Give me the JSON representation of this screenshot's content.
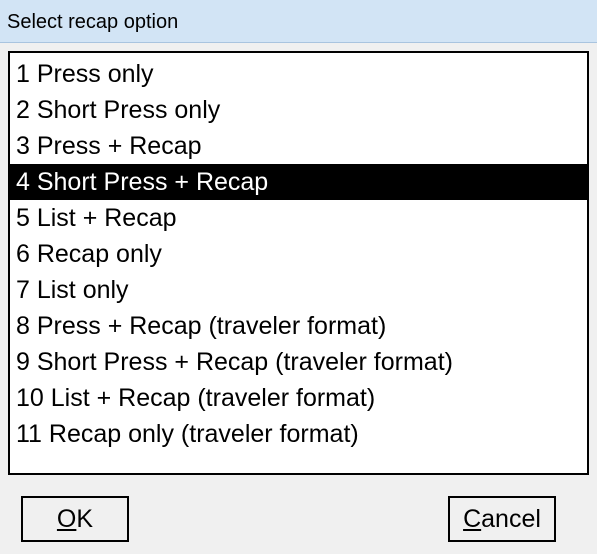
{
  "window": {
    "title": "Select recap option"
  },
  "list": {
    "selected_index": 3,
    "items": [
      {
        "label": "1  Press only"
      },
      {
        "label": "2  Short Press only"
      },
      {
        "label": "3  Press + Recap"
      },
      {
        "label": "4  Short Press + Recap"
      },
      {
        "label": "5  List + Recap"
      },
      {
        "label": "6  Recap only"
      },
      {
        "label": "7  List only"
      },
      {
        "label": "8  Press + Recap (traveler format)"
      },
      {
        "label": "9  Short Press + Recap (traveler format)"
      },
      {
        "label": "10 List + Recap (traveler format)"
      },
      {
        "label": "11 Recap only (traveler format)"
      }
    ]
  },
  "buttons": {
    "ok": {
      "mnemonic": "O",
      "rest": "K"
    },
    "cancel": {
      "mnemonic": "C",
      "rest": "ancel"
    }
  },
  "colors": {
    "titlebar": "#d2e4f5",
    "selection_bg": "#000000",
    "selection_fg": "#ffffff",
    "dialog_bg": "#f0f0f0"
  }
}
